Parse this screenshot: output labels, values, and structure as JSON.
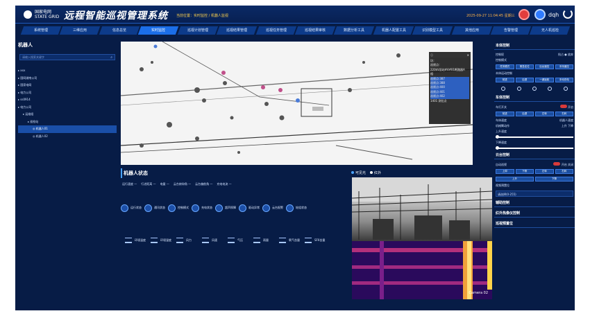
{
  "header": {
    "logo_text_cn": "国家电网",
    "logo_text_en": "STATE GRID",
    "title": "远程智能巡视管理系统",
    "breadcrumb": "当前位置：实时监控 / 机器人监视",
    "datetime": "2025-09-27 11:04:45 星期三",
    "username": "dqh"
  },
  "nav": [
    {
      "label": "系统管理"
    },
    {
      "label": "三维应用"
    },
    {
      "label": "信息总览"
    },
    {
      "label": "实时监控",
      "active": true
    },
    {
      "label": "巡视计划管理"
    },
    {
      "label": "巡视结果管理"
    },
    {
      "label": "巡视任务管理"
    },
    {
      "label": "巡视结果审核"
    },
    {
      "label": "数据分析工具"
    },
    {
      "label": "机器人配置工具"
    },
    {
      "label": "识别模型工具"
    },
    {
      "label": "其他应用"
    },
    {
      "label": "告警管理"
    },
    {
      "label": "无人机巡检"
    }
  ],
  "left_panel": {
    "title": "机器人",
    "search_placeholder": "请输入搜索关键字",
    "tree": [
      {
        "label": "xxx",
        "indent": 0
      },
      {
        "label": "国网湖南公司",
        "indent": 0
      },
      {
        "label": "国家电网",
        "indent": 0
      },
      {
        "label": "电力公司",
        "indent": 0
      },
      {
        "label": "ss0914",
        "indent": 0
      },
      {
        "label": "电力公司",
        "indent": 0
      },
      {
        "label": "运维组",
        "indent": 1
      },
      {
        "label": "巡检站",
        "indent": 2
      },
      {
        "label": "机器人01",
        "indent": 3,
        "selected": true
      },
      {
        "label": "机器人02",
        "indent": 3
      }
    ]
  },
  "map_overlay": {
    "lines": [
      "坊：",
      "巡视点：",
      "220kV总站#4#01断路器A",
      "相",
      "巡视点:387",
      "巡视点:388",
      "巡视点:400",
      "巡视点:401",
      "巡视点:402",
      "1401 测位点"
    ]
  },
  "status": {
    "title": "机器人状态",
    "legend": [
      "运行速度 —",
      "行进距离 —",
      "电量 —",
      "云台俯仰角 —",
      "云台偏航角 —",
      "充电电流 —"
    ],
    "items": [
      {
        "icon": "run-status-icon",
        "label": "运行状态"
      },
      {
        "icon": "comm-status-icon",
        "label": "通讯状态"
      },
      {
        "icon": "control-mode-icon",
        "label": "控制模式"
      },
      {
        "icon": "charge-status-icon",
        "label": "充电状态"
      },
      {
        "icon": "obstacle-icon",
        "label": "超声探障"
      },
      {
        "icon": "drive-alarm-icon",
        "label": "驱动异常"
      },
      {
        "icon": "motor-alarm-icon",
        "label": "云台报警"
      },
      {
        "icon": "wheel-status-icon",
        "label": "轮组状态"
      }
    ],
    "env": [
      {
        "icon": "env-temp-icon",
        "label": "环境温度"
      },
      {
        "icon": "env-humidity-icon",
        "label": "环境湿度"
      },
      {
        "icon": "wind-power-icon",
        "label": "风力"
      },
      {
        "icon": "wind-speed-icon",
        "label": "风速"
      },
      {
        "icon": "pressure-icon",
        "label": "气压"
      },
      {
        "icon": "rain-icon",
        "label": "雨量"
      },
      {
        "icon": "sf6-icon",
        "label": "氧气含量"
      },
      {
        "icon": "sf6-gas-icon",
        "label": "SF6含量"
      }
    ]
  },
  "video": {
    "tabs": [
      "可见光",
      "红外"
    ],
    "thermal_label": "Camera 02"
  },
  "right_panel": {
    "s1": {
      "title": "本体控制",
      "mode_label": "控制权",
      "opt_a": "抢占",
      "opt_b": "放弃",
      "sub_label": "控制模式",
      "buttons_1": [
        "任务模式",
        "紧急定位",
        "后台遥控",
        "手持遥控"
      ],
      "sub_label2": "本体运动控制",
      "buttons_2": [
        "前进",
        "后退",
        "一键返航",
        "手动充电"
      ]
    },
    "s2": {
      "title": "车体控制",
      "row1_label": "车灯开关",
      "row1_value": "开启",
      "buttons_1": [
        "前进",
        "后退",
        "左转",
        "右转"
      ],
      "row2_label": "车体速度",
      "row2_value": "机器人速度",
      "row3_label": "机械臂动作",
      "row3_a": "上升",
      "row3_b": "下降",
      "slider1": "上升速度",
      "slider2": "下降速度"
    },
    "s3": {
      "title": "云台控制",
      "row1_label": "自动巡视",
      "row1_a": "开启",
      "row1_b": "关闭",
      "buttons_1": [
        "上仰",
        "下俯",
        "左转",
        "右转"
      ],
      "buttons_2": [
        "上升",
        "下降"
      ],
      "row2_label": "视频预置位",
      "select_value": "请选择(0-255)"
    },
    "s4": {
      "title": "辅助控制"
    },
    "s5": {
      "title": "红外热像仪控制"
    },
    "s6": {
      "title": "巡视预置位"
    }
  }
}
